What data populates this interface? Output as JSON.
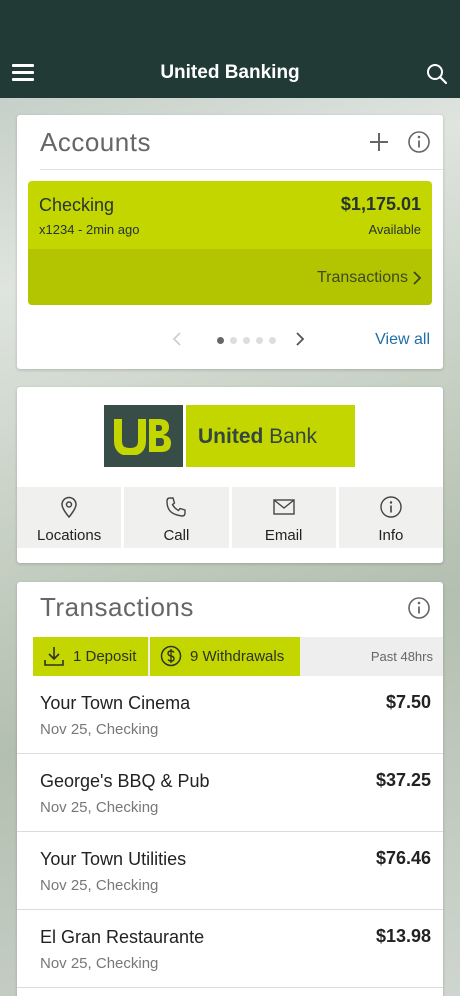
{
  "app": {
    "title": "United Banking"
  },
  "accounts": {
    "title": "Accounts",
    "account": {
      "name": "Checking",
      "subtitle": "x1234 - 2min ago",
      "balance": "$1,175.01",
      "balance_label": "Available",
      "link_label": "Transactions"
    },
    "pager": {
      "total": 5,
      "active": 1
    },
    "view_all": "View all"
  },
  "bank": {
    "logo_mark": "UB",
    "name_part1": "United",
    "name_part2": " Bank",
    "actions": [
      {
        "label": "Locations",
        "icon": "location-pin-icon"
      },
      {
        "label": "Call",
        "icon": "phone-icon"
      },
      {
        "label": "Email",
        "icon": "envelope-icon"
      },
      {
        "label": "Info",
        "icon": "info-icon"
      }
    ]
  },
  "transactions": {
    "title": "Transactions",
    "deposits_label": "1 Deposit",
    "withdrawals_label": "9 Withdrawals",
    "period": "Past 48hrs",
    "items": [
      {
        "merchant": "Your Town Cinema",
        "meta": "Nov 25, Checking",
        "amount": "$7.50"
      },
      {
        "merchant": "George's BBQ & Pub",
        "meta": "Nov 25, Checking",
        "amount": "$37.25"
      },
      {
        "merchant": "Your Town Utilities",
        "meta": "Nov 25, Checking",
        "amount": "$76.46"
      },
      {
        "merchant": "El Gran Restaurante",
        "meta": "Nov 25, Checking",
        "amount": "$13.98"
      }
    ]
  },
  "colors": {
    "header": "#213a36",
    "accent": "#c4d600",
    "accent_dark": "#b3c500",
    "link": "#1f6fa8"
  }
}
